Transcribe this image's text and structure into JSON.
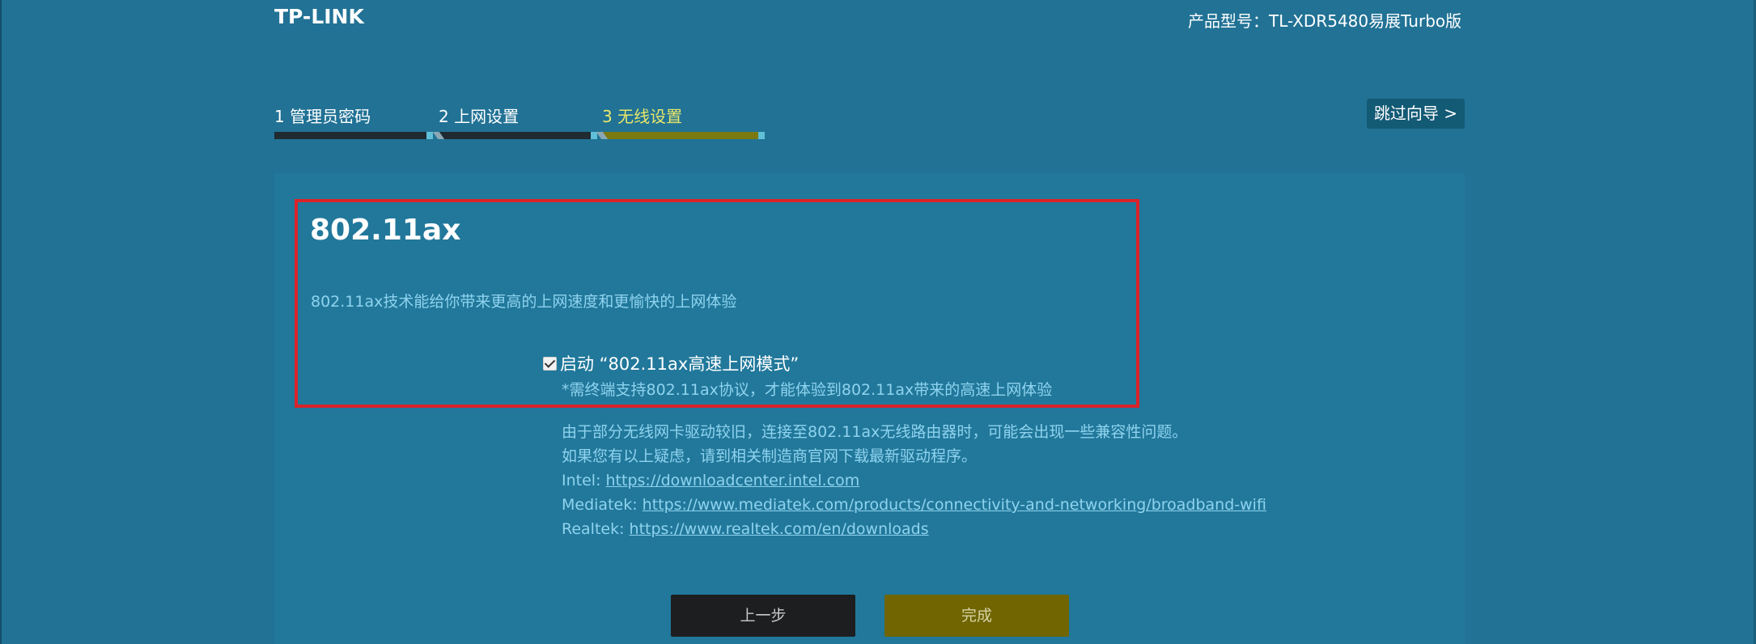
{
  "header": {
    "logo": "TP-LINK",
    "model_text": "产品型号：TL-XDR5480易展Turbo版"
  },
  "steps": [
    {
      "label": "1 管理员密码",
      "active": false
    },
    {
      "label": "2 上网设置",
      "active": false
    },
    {
      "label": "3 无线设置",
      "active": true
    }
  ],
  "skip_button": "跳过向导 >",
  "feature": {
    "title": "802.11ax",
    "description": "802.11ax技术能给你带来更高的上网速度和更愉快的上网体验",
    "checkbox_label": "启动 “802.11ax高速上网模式”",
    "checkbox_checked": true,
    "note": "*需终端支持802.11ax协议，才能体验到802.11ax带来的高速上网体验"
  },
  "info": {
    "line1": "由于部分无线网卡驱动较旧，连接至802.11ax无线路由器时，可能会出现一些兼容性问题。",
    "line2": "如果您有以上疑虑，请到相关制造商官网下载最新驱动程序。",
    "links": [
      {
        "vendor": "Intel:",
        "url": "https://downloadcenter.intel.com"
      },
      {
        "vendor": "Mediatek:",
        "url": "https://www.mediatek.com/products/connectivity-and-networking/broadband-wifi"
      },
      {
        "vendor": "Realtek:",
        "url": "https://www.realtek.com/en/downloads"
      }
    ]
  },
  "buttons": {
    "prev": "上一步",
    "finish": "完成"
  },
  "colors": {
    "background": "#217295",
    "panel": "#21789b",
    "accent_active_step": "#e8e66a",
    "highlight_border": "#d9232a",
    "link": "#8fd3ee",
    "finish_button": "#706500"
  }
}
